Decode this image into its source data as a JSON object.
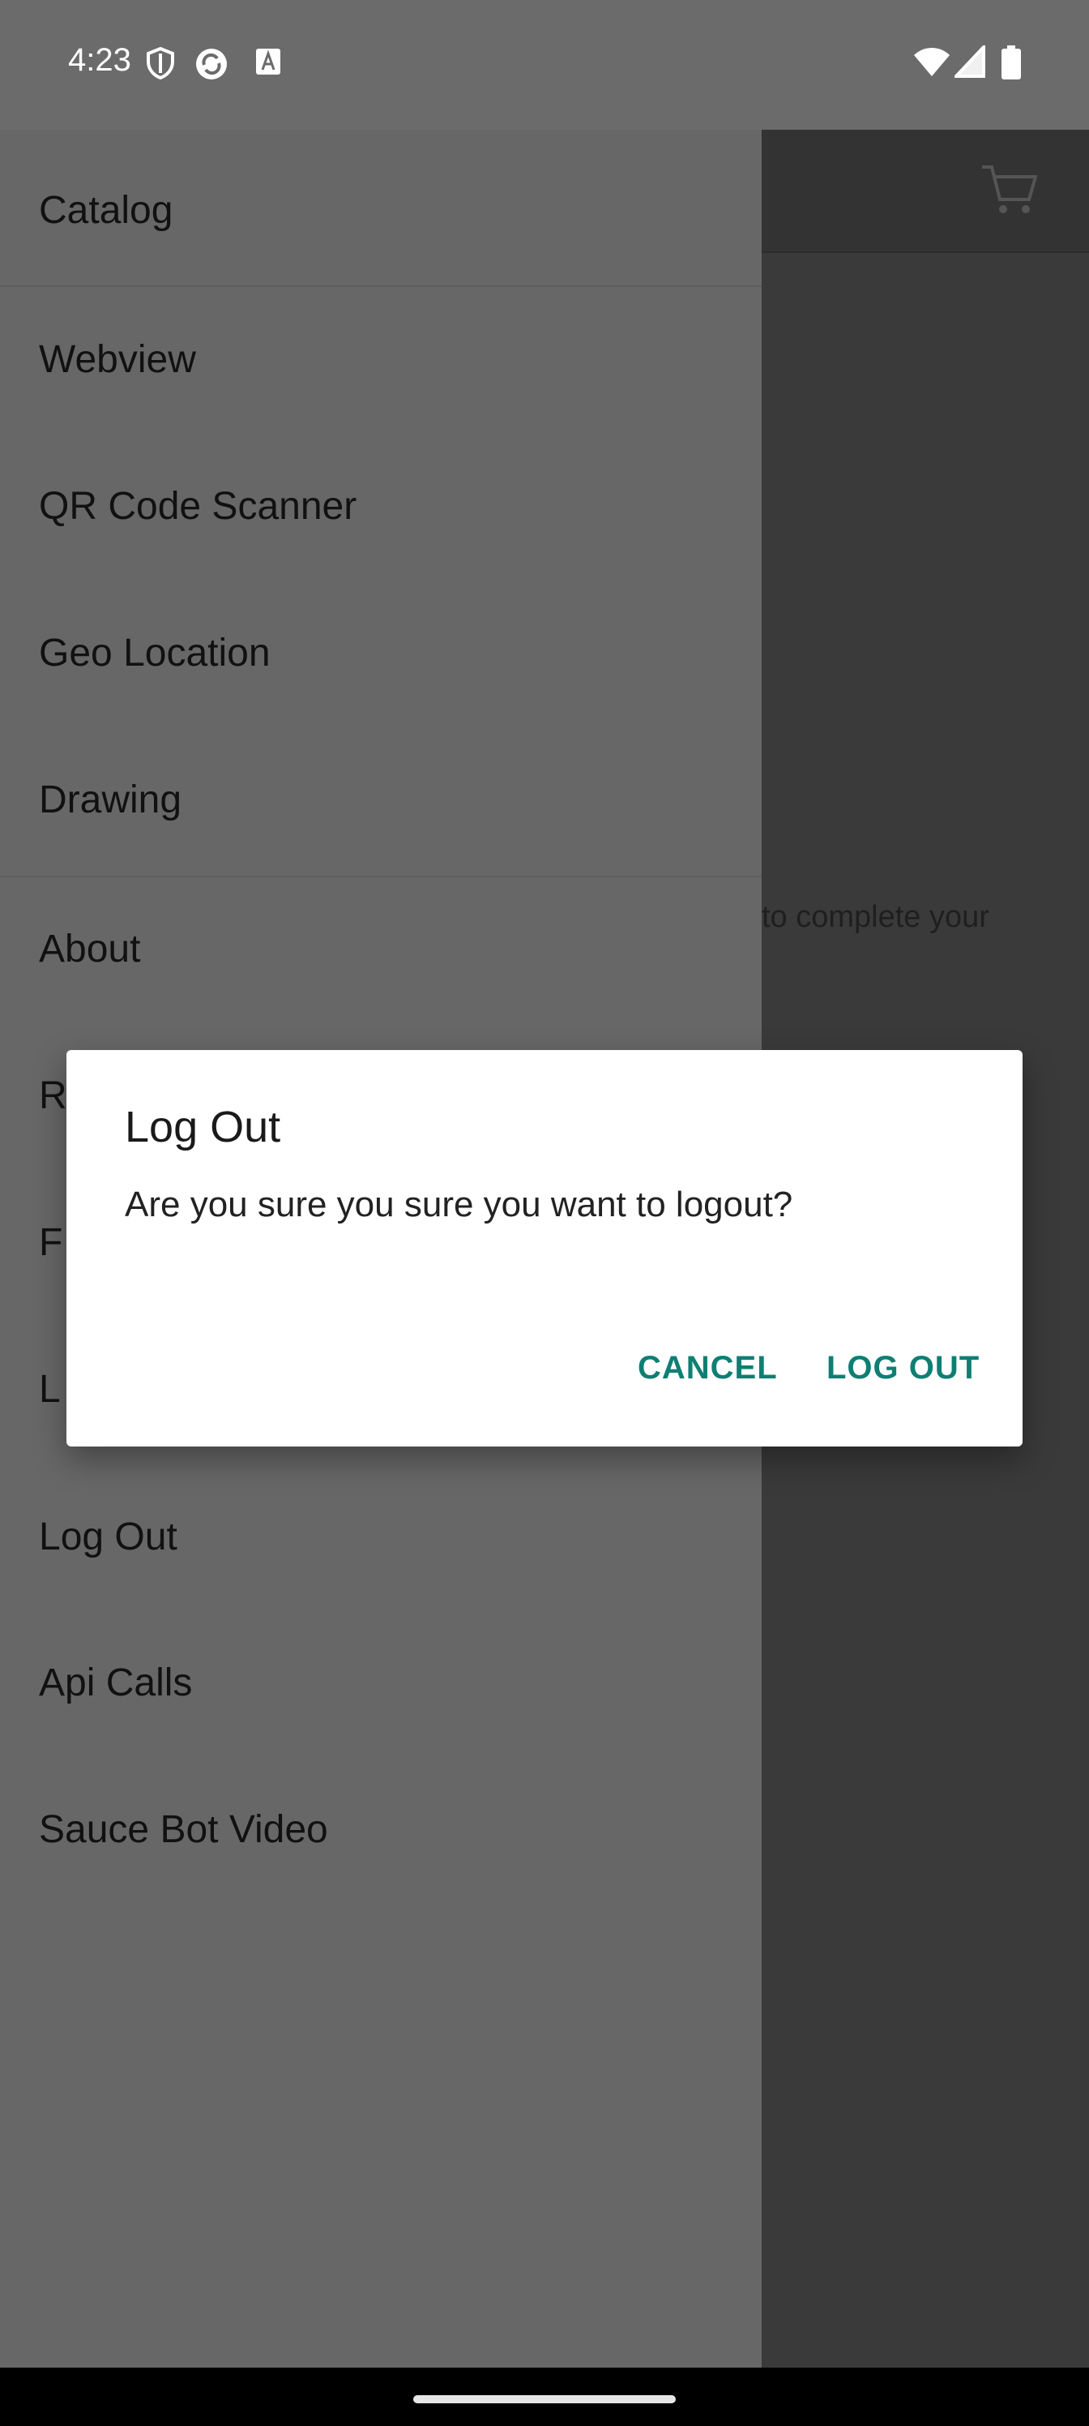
{
  "status_bar": {
    "time": "4:23",
    "left_icons": [
      "shield-icon",
      "sync-icon",
      "font-icon"
    ],
    "right_icons": [
      "wifi-icon",
      "signal-icon",
      "battery-icon"
    ]
  },
  "background_app": {
    "toolbar_icon": "cart-icon",
    "partial_text": "to complete your"
  },
  "drawer": {
    "items": [
      {
        "label": "Catalog"
      },
      {
        "label": "Webview"
      },
      {
        "label": "QR Code Scanner"
      },
      {
        "label": "Geo Location"
      },
      {
        "label": "Drawing"
      },
      {
        "label": "About"
      },
      {
        "label": "R"
      },
      {
        "label": "F"
      },
      {
        "label": "L"
      },
      {
        "label": "Log Out"
      },
      {
        "label": "Api Calls"
      },
      {
        "label": "Sauce Bot Video"
      }
    ]
  },
  "dialog": {
    "title": "Log Out",
    "message": "Are you sure you sure you want to logout?",
    "cancel_label": "CANCEL",
    "confirm_label": "LOG OUT",
    "accent_color": "#0e7f72"
  }
}
